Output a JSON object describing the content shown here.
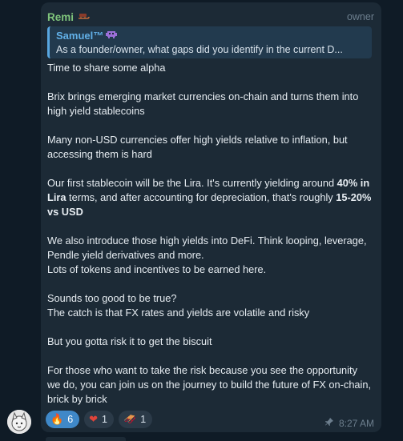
{
  "message": {
    "sender": "Remi",
    "sender_emoji": "sled-emoji",
    "role": "owner",
    "reply": {
      "name": "Samuel™",
      "emoji": "alien-monster-emoji",
      "text": "As a founder/owner, what gaps did you identify in the current D..."
    },
    "paragraphs": [
      "Time to share some alpha",
      "Brix brings emerging market currencies on-chain and turns them into high yield stablecoins",
      "Many non-USD currencies offer high yields relative to inflation, but accessing them is hard"
    ],
    "lira_para": {
      "p1": "Our first stablecoin will be the Lira. It's currently yielding around ",
      "b1": "40% in Lira",
      "p2": " terms, and after accounting for depreciation, that's roughly ",
      "b2": "15-20% vs USD"
    },
    "defi_lines": [
      "We also introduce those high yields into DeFi. Think looping, leverage, Pendle yield derivatives and more.",
      "Lots of tokens and incentives to be earned here."
    ],
    "catch_lines": [
      "Sounds too good to be true?",
      "The catch is that FX rates and yields are volatile and risky"
    ],
    "biscuit": "But you gotta risk it to get the biscuit",
    "closing": "For those who want to take the risk because you see the opportunity we do, you can join us on the journey to build the future of FX on-chain, brick by brick",
    "reactions": [
      {
        "icon": "fire-icon",
        "glyph": "🔥",
        "count": "6",
        "active": true
      },
      {
        "icon": "heart-on-fire-icon",
        "glyph": "❤",
        "count": "1",
        "active": false
      },
      {
        "icon": "sled-icon",
        "glyph": "🛷",
        "count": "1",
        "active": false
      }
    ],
    "time": "8:27 AM",
    "pinned_icon": "pin-icon",
    "colors": {
      "sender": "#7fc47b",
      "reply_name": "#62b0e8",
      "reply_border": "#58a7e0",
      "active_reaction": "#3f88c8",
      "bubble": "#1c2a36",
      "background": "#0f1b26"
    }
  }
}
